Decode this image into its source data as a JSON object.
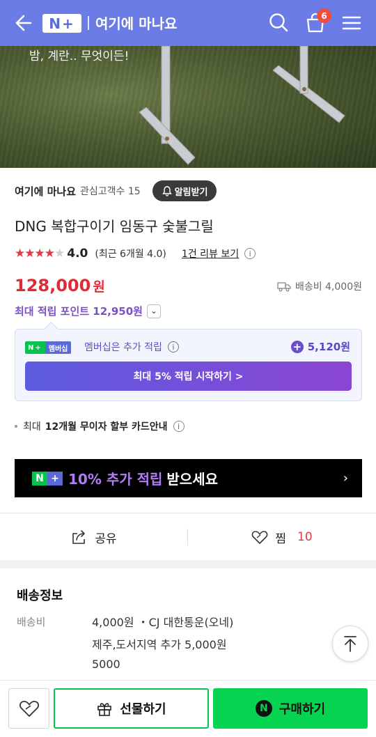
{
  "header": {
    "logo_text": "N+",
    "store_title": "여기에 마나요",
    "cart_count": "6"
  },
  "hero": {
    "caption": "밤, 계란.. 무엇이든!"
  },
  "store": {
    "name": "여기에 마나요",
    "fans": "관심고객수 15",
    "alarm_label": "알림받기"
  },
  "product": {
    "title": "DNG 복합구이기 임동구 숯불그릴",
    "rating": "4.0",
    "rating_value": 4,
    "rating_max": 5,
    "recent_rating": "(최근 6개월 4.0)",
    "review_link": "1건 리뷰 보기",
    "price": "128,000",
    "price_unit": "원",
    "shipping_fee": "배송비 4,000원",
    "max_points": "최대 적립 포인트 12,950원"
  },
  "membership": {
    "badge_left": "N+",
    "badge_right": "멤버십",
    "text": "멤버십은 추가 적립",
    "bonus": "5,120원",
    "button": "최대 5% 적립 시작하기 >"
  },
  "installment": {
    "prefix": "최대",
    "text": "12개월 무이자 할부 카드안내"
  },
  "banner": {
    "accent": "10% 추가 적립",
    "rest": "받으세요",
    "arrow": "›"
  },
  "actions": {
    "share_label": "공유",
    "wish_label": "찜",
    "wish_count": "10"
  },
  "delivery": {
    "title": "배송정보",
    "label": "배송비",
    "line1": "4,000원 ・CJ 대한통운(오네)",
    "line2": "제주,도서지역 추가 5,000원",
    "line3": "5000"
  },
  "bottom_bar": {
    "gift_label": "선물하기",
    "buy_label": "구매하기",
    "n_mark": "N"
  },
  "colors": {
    "header_bg": "#6b7ce6",
    "price_red": "#e02b37",
    "points_purple": "#7c50c4",
    "naver_green": "#06d34f"
  }
}
